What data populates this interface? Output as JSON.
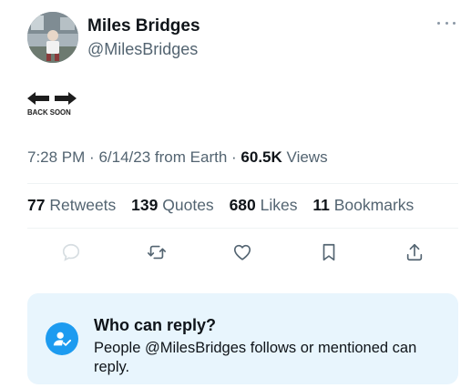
{
  "author": {
    "display_name": "Miles Bridges",
    "handle": "@MilesBridges"
  },
  "tweet": {
    "graphic_text": "BACK SOON"
  },
  "meta": {
    "time": "7:28 PM",
    "date": "6/14/23",
    "source": "from Earth",
    "views_count": "60.5K",
    "views_label": "Views"
  },
  "stats": [
    {
      "count": "77",
      "label": "Retweets"
    },
    {
      "count": "139",
      "label": "Quotes"
    },
    {
      "count": "680",
      "label": "Likes"
    },
    {
      "count": "11",
      "label": "Bookmarks"
    }
  ],
  "reply_settings": {
    "title": "Who can reply?",
    "description": "People @MilesBridges follows or mentioned can reply."
  },
  "colors": {
    "accent": "#1d9bf0",
    "secondary_text": "#536471",
    "reply_box_bg": "#e8f5fd"
  }
}
